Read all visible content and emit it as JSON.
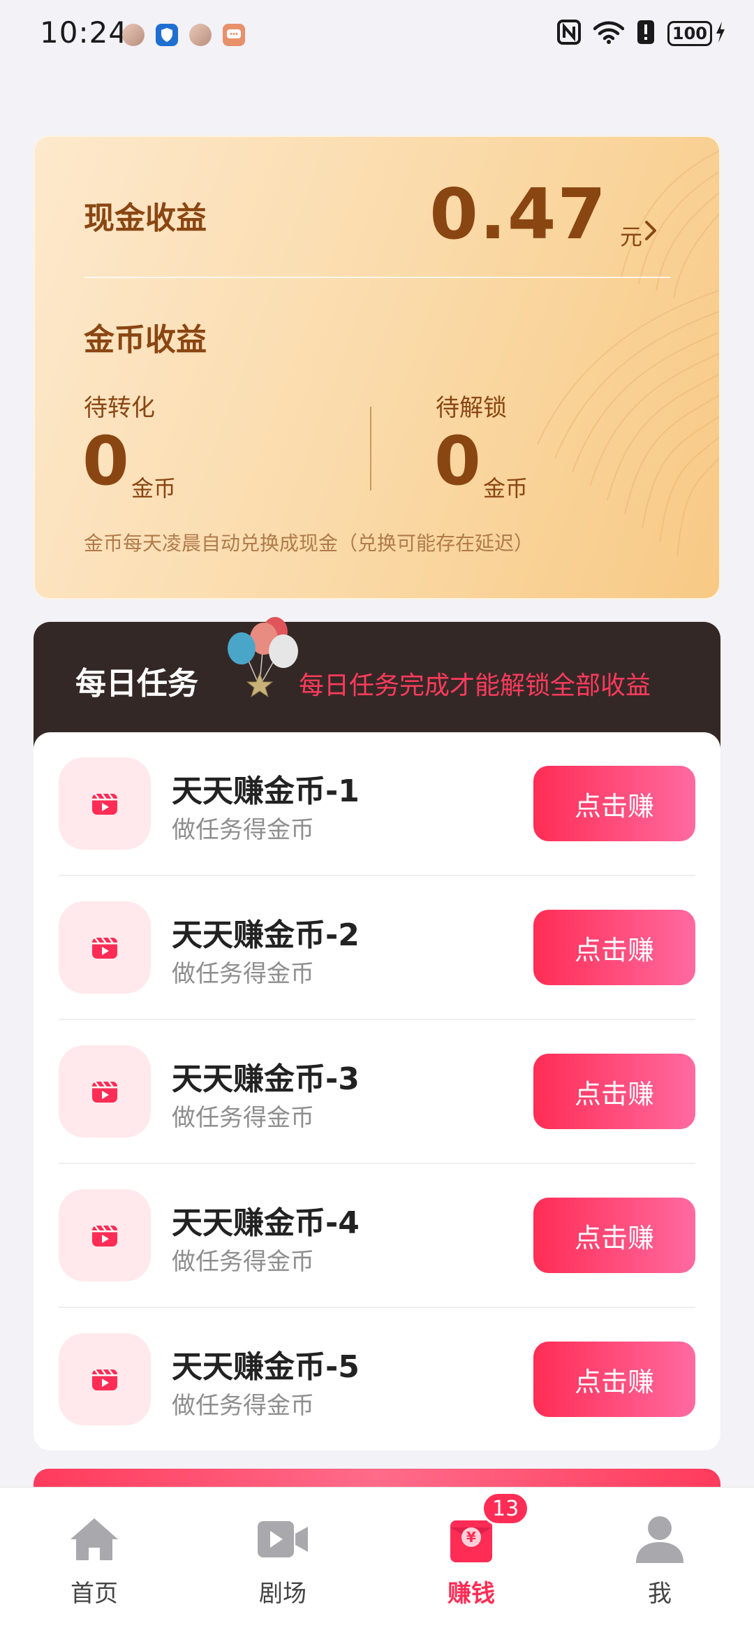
{
  "status_bar": {
    "time": "10:24",
    "battery": "100",
    "notification_icons": [
      "avatar-icon",
      "shield-icon",
      "avatar-icon",
      "chat-icon"
    ],
    "system_icons": [
      "nfc-icon",
      "wifi-icon",
      "alert-icon",
      "battery-icon",
      "charging-icon"
    ]
  },
  "earnings": {
    "cash_label": "现金收益",
    "cash_value": "0.47",
    "cash_unit": "元",
    "coin_label": "金币收益",
    "pending_label": "待转化",
    "pending_value": "0",
    "pending_unit": "金币",
    "locked_label": "待解锁",
    "locked_value": "0",
    "locked_unit": "金币",
    "note": "金币每天凌晨自动兑换成现金（兑换可能存在延迟）"
  },
  "daily_tasks": {
    "title": "每日任务",
    "subtitle": "每日任务完成才能解锁全部收益",
    "items": [
      {
        "name": "天天赚金币-1",
        "desc": "做任务得金币",
        "button": "点击赚"
      },
      {
        "name": "天天赚金币-2",
        "desc": "做任务得金币",
        "button": "点击赚"
      },
      {
        "name": "天天赚金币-3",
        "desc": "做任务得金币",
        "button": "点击赚"
      },
      {
        "name": "天天赚金币-4",
        "desc": "做任务得金币",
        "button": "点击赚"
      },
      {
        "name": "天天赚金币-5",
        "desc": "做任务得金币",
        "button": "点击赚"
      }
    ]
  },
  "bottom_nav": {
    "items": [
      {
        "label": "首页",
        "icon": "home-icon",
        "active": false
      },
      {
        "label": "剧场",
        "icon": "video-camera-icon",
        "active": false
      },
      {
        "label": "赚钱",
        "icon": "red-envelope-icon",
        "active": true,
        "badge": "13"
      },
      {
        "label": "我",
        "icon": "profile-icon",
        "active": false
      }
    ]
  },
  "colors": {
    "accent": "#ff2d55",
    "card_text": "#8a4612",
    "tasks_header_bg": "#342826",
    "icon_bg": "#ffe9ec"
  }
}
